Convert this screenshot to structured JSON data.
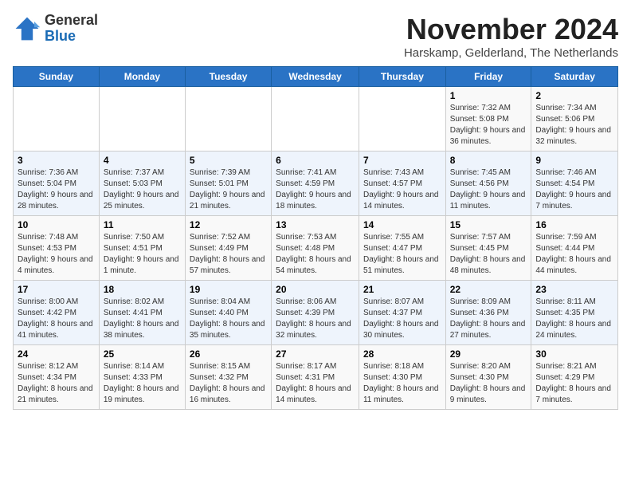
{
  "logo": {
    "general": "General",
    "blue": "Blue"
  },
  "title": "November 2024",
  "location": "Harskamp, Gelderland, The Netherlands",
  "days_of_week": [
    "Sunday",
    "Monday",
    "Tuesday",
    "Wednesday",
    "Thursday",
    "Friday",
    "Saturday"
  ],
  "weeks": [
    [
      {
        "day": "",
        "info": ""
      },
      {
        "day": "",
        "info": ""
      },
      {
        "day": "",
        "info": ""
      },
      {
        "day": "",
        "info": ""
      },
      {
        "day": "",
        "info": ""
      },
      {
        "day": "1",
        "info": "Sunrise: 7:32 AM\nSunset: 5:08 PM\nDaylight: 9 hours and 36 minutes."
      },
      {
        "day": "2",
        "info": "Sunrise: 7:34 AM\nSunset: 5:06 PM\nDaylight: 9 hours and 32 minutes."
      }
    ],
    [
      {
        "day": "3",
        "info": "Sunrise: 7:36 AM\nSunset: 5:04 PM\nDaylight: 9 hours and 28 minutes."
      },
      {
        "day": "4",
        "info": "Sunrise: 7:37 AM\nSunset: 5:03 PM\nDaylight: 9 hours and 25 minutes."
      },
      {
        "day": "5",
        "info": "Sunrise: 7:39 AM\nSunset: 5:01 PM\nDaylight: 9 hours and 21 minutes."
      },
      {
        "day": "6",
        "info": "Sunrise: 7:41 AM\nSunset: 4:59 PM\nDaylight: 9 hours and 18 minutes."
      },
      {
        "day": "7",
        "info": "Sunrise: 7:43 AM\nSunset: 4:57 PM\nDaylight: 9 hours and 14 minutes."
      },
      {
        "day": "8",
        "info": "Sunrise: 7:45 AM\nSunset: 4:56 PM\nDaylight: 9 hours and 11 minutes."
      },
      {
        "day": "9",
        "info": "Sunrise: 7:46 AM\nSunset: 4:54 PM\nDaylight: 9 hours and 7 minutes."
      }
    ],
    [
      {
        "day": "10",
        "info": "Sunrise: 7:48 AM\nSunset: 4:53 PM\nDaylight: 9 hours and 4 minutes."
      },
      {
        "day": "11",
        "info": "Sunrise: 7:50 AM\nSunset: 4:51 PM\nDaylight: 9 hours and 1 minute."
      },
      {
        "day": "12",
        "info": "Sunrise: 7:52 AM\nSunset: 4:49 PM\nDaylight: 8 hours and 57 minutes."
      },
      {
        "day": "13",
        "info": "Sunrise: 7:53 AM\nSunset: 4:48 PM\nDaylight: 8 hours and 54 minutes."
      },
      {
        "day": "14",
        "info": "Sunrise: 7:55 AM\nSunset: 4:47 PM\nDaylight: 8 hours and 51 minutes."
      },
      {
        "day": "15",
        "info": "Sunrise: 7:57 AM\nSunset: 4:45 PM\nDaylight: 8 hours and 48 minutes."
      },
      {
        "day": "16",
        "info": "Sunrise: 7:59 AM\nSunset: 4:44 PM\nDaylight: 8 hours and 44 minutes."
      }
    ],
    [
      {
        "day": "17",
        "info": "Sunrise: 8:00 AM\nSunset: 4:42 PM\nDaylight: 8 hours and 41 minutes."
      },
      {
        "day": "18",
        "info": "Sunrise: 8:02 AM\nSunset: 4:41 PM\nDaylight: 8 hours and 38 minutes."
      },
      {
        "day": "19",
        "info": "Sunrise: 8:04 AM\nSunset: 4:40 PM\nDaylight: 8 hours and 35 minutes."
      },
      {
        "day": "20",
        "info": "Sunrise: 8:06 AM\nSunset: 4:39 PM\nDaylight: 8 hours and 32 minutes."
      },
      {
        "day": "21",
        "info": "Sunrise: 8:07 AM\nSunset: 4:37 PM\nDaylight: 8 hours and 30 minutes."
      },
      {
        "day": "22",
        "info": "Sunrise: 8:09 AM\nSunset: 4:36 PM\nDaylight: 8 hours and 27 minutes."
      },
      {
        "day": "23",
        "info": "Sunrise: 8:11 AM\nSunset: 4:35 PM\nDaylight: 8 hours and 24 minutes."
      }
    ],
    [
      {
        "day": "24",
        "info": "Sunrise: 8:12 AM\nSunset: 4:34 PM\nDaylight: 8 hours and 21 minutes."
      },
      {
        "day": "25",
        "info": "Sunrise: 8:14 AM\nSunset: 4:33 PM\nDaylight: 8 hours and 19 minutes."
      },
      {
        "day": "26",
        "info": "Sunrise: 8:15 AM\nSunset: 4:32 PM\nDaylight: 8 hours and 16 minutes."
      },
      {
        "day": "27",
        "info": "Sunrise: 8:17 AM\nSunset: 4:31 PM\nDaylight: 8 hours and 14 minutes."
      },
      {
        "day": "28",
        "info": "Sunrise: 8:18 AM\nSunset: 4:30 PM\nDaylight: 8 hours and 11 minutes."
      },
      {
        "day": "29",
        "info": "Sunrise: 8:20 AM\nSunset: 4:30 PM\nDaylight: 8 hours and 9 minutes."
      },
      {
        "day": "30",
        "info": "Sunrise: 8:21 AM\nSunset: 4:29 PM\nDaylight: 8 hours and 7 minutes."
      }
    ]
  ]
}
